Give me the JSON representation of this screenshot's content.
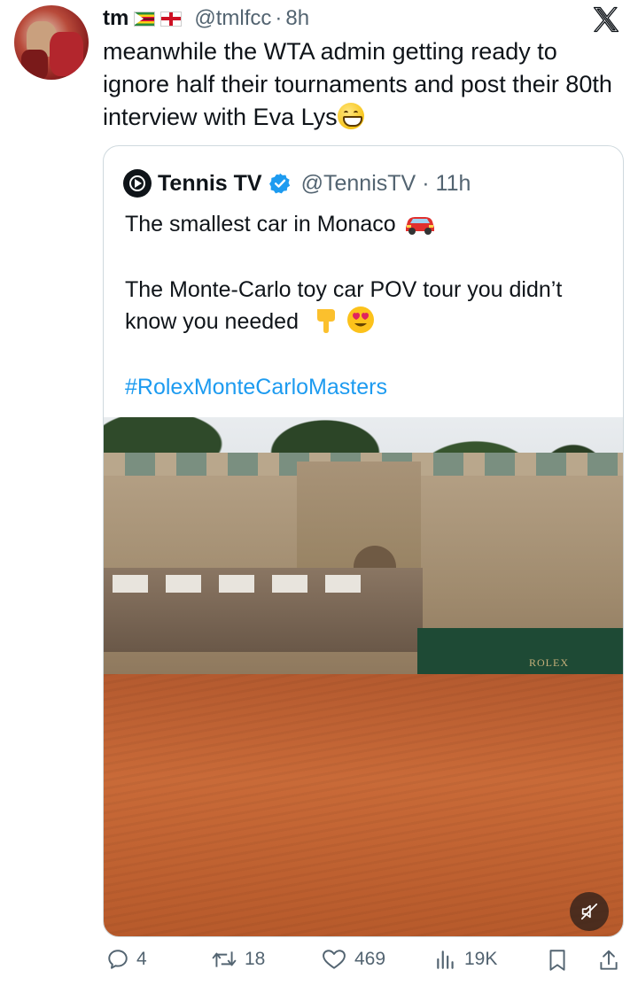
{
  "tweet": {
    "display_name": "tm",
    "flags": [
      "zimbabwe-flag",
      "england-flag"
    ],
    "handle": "@tmlfcc",
    "separator": "·",
    "time": "8h",
    "text": "meanwhile the WTA admin getting ready to ignore half their tournaments and post their 80th interview with Eva Lys",
    "emoji": "grinning-face-icon"
  },
  "quoted_tweet": {
    "display_name": "Tennis TV",
    "verified": true,
    "handle": "@TennisTV",
    "separator": "·",
    "time": "11h",
    "line1": "The smallest car in Monaco",
    "line2": "The Monte-Carlo toy car POV tour you didn’t know you needed",
    "hashtag": "#RolexMonteCarloMasters",
    "video_overlay_text": "ROLEX",
    "video_muted": true
  },
  "actions": {
    "replies": "4",
    "reposts": "18",
    "likes": "469",
    "views": "19K"
  },
  "colors": {
    "accent": "#1d9bf0",
    "secondary_text": "#536471",
    "primary_text": "#0f1419",
    "border": "#cfd9de"
  }
}
